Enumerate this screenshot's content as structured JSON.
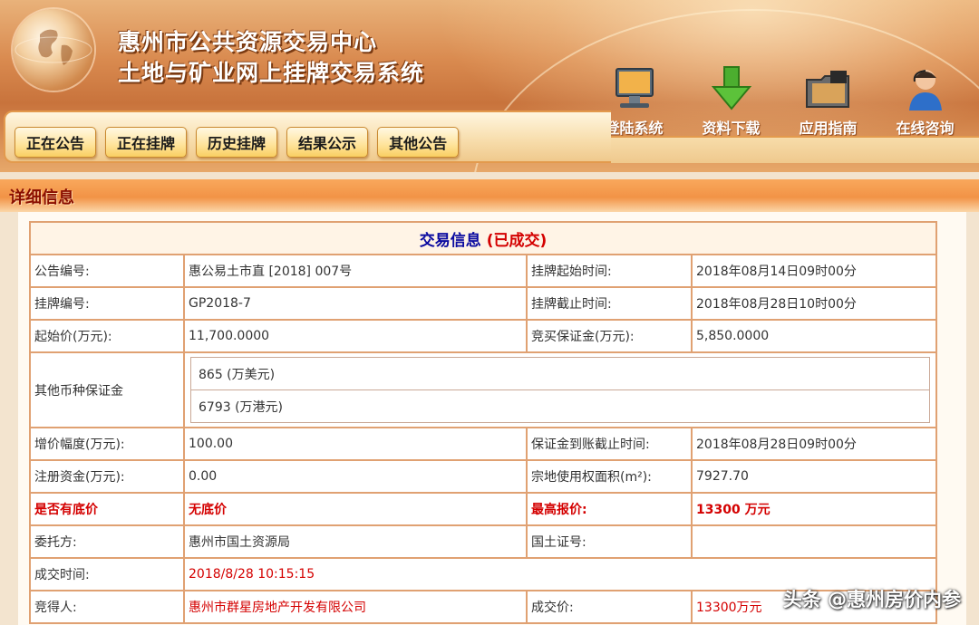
{
  "header": {
    "title_line1": "惠州市公共资源交易中心",
    "title_line2": "土地与矿业网上挂牌交易系统",
    "quick_links": [
      {
        "label": "登陆系统",
        "icon": "monitor-icon"
      },
      {
        "label": "资料下载",
        "icon": "download-arrow-icon"
      },
      {
        "label": "应用指南",
        "icon": "folder-guide-icon"
      },
      {
        "label": "在线咨询",
        "icon": "support-agent-icon"
      }
    ]
  },
  "nav": {
    "tabs": [
      "正在公告",
      "正在挂牌",
      "历史挂牌",
      "结果公示",
      "其他公告"
    ]
  },
  "section": {
    "title": "详细信息"
  },
  "info": {
    "title": "交易信息",
    "status": "(已成交)",
    "rows": {
      "notice_no_label": "公告编号:",
      "notice_no_value": "惠公易土市直 [2018] 007号",
      "listing_start_label": "挂牌起始时间:",
      "listing_start_value": "2018年08月14日09时00分",
      "listing_no_label": "挂牌编号:",
      "listing_no_value": "GP2018-7",
      "listing_end_label": "挂牌截止时间:",
      "listing_end_value": "2018年08月28日10时00分",
      "start_price_label": "起始价(万元):",
      "start_price_value": "11,700.0000",
      "deposit_label": "竞买保证金(万元):",
      "deposit_value": "5,850.0000",
      "other_currency_label": "其他币种保证金",
      "other_currency_values": [
        "865 (万美元)",
        "6793 (万港元)"
      ],
      "increment_label": "增价幅度(万元):",
      "increment_value": "100.00",
      "deposit_deadline_label": "保证金到账截止时间:",
      "deposit_deadline_value": "2018年08月28日09时00分",
      "reg_capital_label": "注册资金(万元):",
      "reg_capital_value": "0.00",
      "land_area_label": "宗地使用权面积(m²):",
      "land_area_value": "7927.70",
      "reserve_label": "是否有底价",
      "reserve_value": "无底价",
      "max_bid_label": "最高报价:",
      "max_bid_value": "13300 万元",
      "entrusted_label": "委托方:",
      "entrusted_value": "惠州市国土资源局",
      "cert_label": "国土证号:",
      "cert_value": "",
      "deal_time_label": "成交时间:",
      "deal_time_value": "2018/8/28 10:15:15",
      "winner_label": "竞得人:",
      "winner_value": "惠州市群星房地产开发有限公司",
      "deal_price_label": "成交价:",
      "deal_price_value": "13300万元"
    }
  },
  "watermark": "头条 @惠州房价内参",
  "colors": {
    "accent_red": "#d40000",
    "title_blue": "#0a0aa0",
    "border": "#e0a172",
    "header_orange": "#d98a4f"
  }
}
